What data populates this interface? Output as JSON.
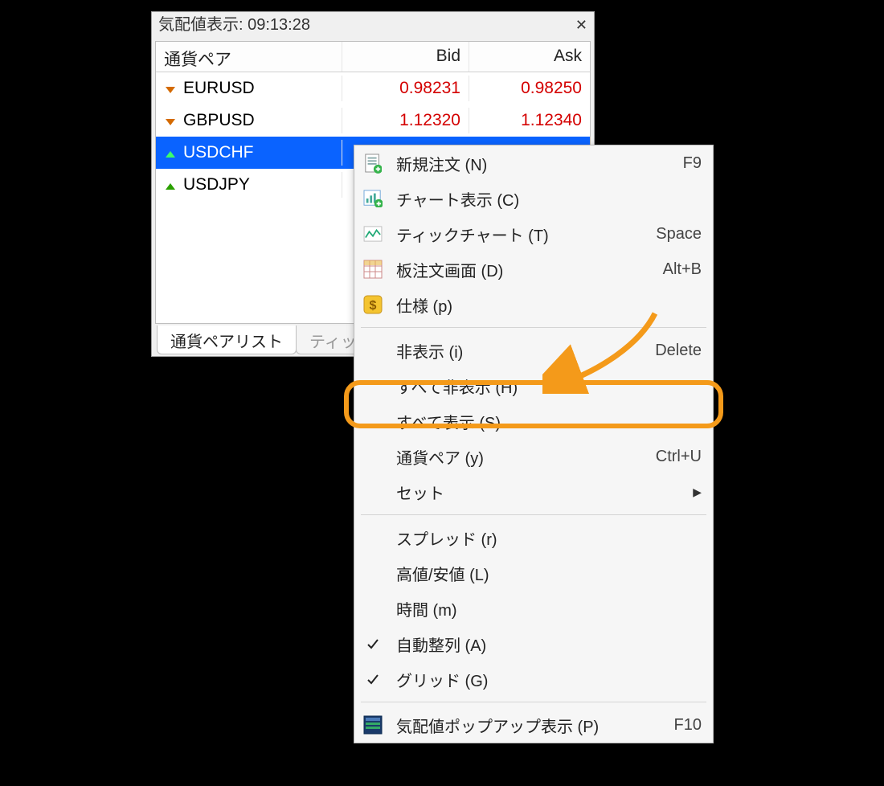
{
  "panel": {
    "title": "気配値表示: 09:13:28",
    "columns": {
      "symbol": "通貨ペア",
      "bid": "Bid",
      "ask": "Ask"
    },
    "rows": [
      {
        "dir": "down",
        "sym": "EURUSD",
        "bid": "0.98231",
        "ask": "0.98250"
      },
      {
        "dir": "down",
        "sym": "GBPUSD",
        "bid": "1.12320",
        "ask": "1.12340"
      },
      {
        "dir": "up",
        "sym": "USDCHF",
        "bid": "",
        "ask": "",
        "selected": true
      },
      {
        "dir": "up",
        "sym": "USDJPY",
        "bid": "",
        "ask": ""
      }
    ],
    "tabs": {
      "active": "通貨ペアリスト",
      "inactive": "ティッ"
    }
  },
  "menu": {
    "items": [
      {
        "icon": "doc-plus",
        "label": "新規注文 (N)",
        "shortcut": "F9"
      },
      {
        "icon": "chart-plus",
        "label": "チャート表示 (C)"
      },
      {
        "icon": "tick",
        "label": "ティックチャート (T)",
        "shortcut": "Space"
      },
      {
        "icon": "grid",
        "label": "板注文画面 (D)",
        "shortcut": "Alt+B"
      },
      {
        "icon": "dollar",
        "label": "仕様 (p)"
      }
    ],
    "items2": [
      {
        "label": "非表示 (i)",
        "shortcut": "Delete"
      },
      {
        "label": "すべて非表示 (H)",
        "highlight": true
      },
      {
        "label": "すべて表示 (S)"
      },
      {
        "label": "通貨ペア (y)",
        "shortcut": "Ctrl+U"
      },
      {
        "label": "セット",
        "submenu": true
      }
    ],
    "items3": [
      {
        "label": "スプレッド (r)"
      },
      {
        "label": "高値/安値 (L)"
      },
      {
        "label": "時間 (m)"
      },
      {
        "icon": "check",
        "label": "自動整列 (A)"
      },
      {
        "icon": "check",
        "label": "グリッド (G)"
      }
    ],
    "items4": [
      {
        "icon": "popup",
        "label": "気配値ポップアップ表示 (P)",
        "shortcut": "F10"
      }
    ]
  }
}
